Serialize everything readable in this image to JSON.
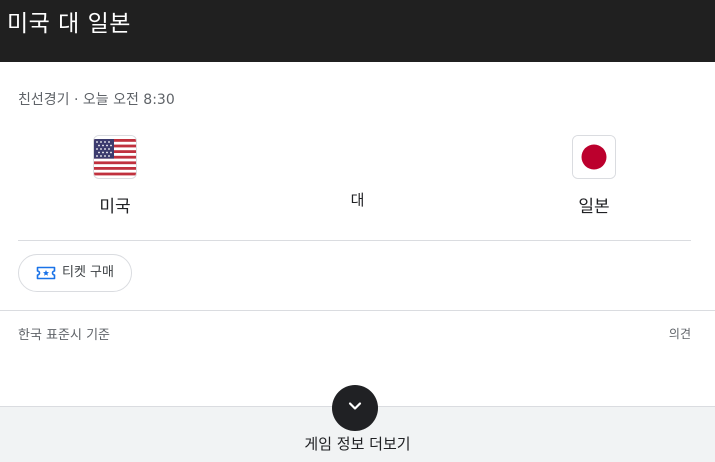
{
  "header": {
    "title": "미국 대 일본",
    "background_color": "#202020"
  },
  "match": {
    "meta": "친선경기 · 오늘 오전 8:30",
    "home_team": {
      "name": "미국",
      "flag_icon": "us-flag-icon"
    },
    "versus_label": "대",
    "away_team": {
      "name": "일본",
      "flag_icon": "japan-flag-icon"
    }
  },
  "actions": {
    "ticket_label": "티켓 구매",
    "ticket_icon": "ticket-icon",
    "accent_color": "#1a73e8"
  },
  "footer": {
    "timezone_note": "한국 표준시 기준",
    "feedback_label": "의견",
    "more_label": "게임 정보 더보기",
    "expand_icon": "chevron-down-icon"
  }
}
